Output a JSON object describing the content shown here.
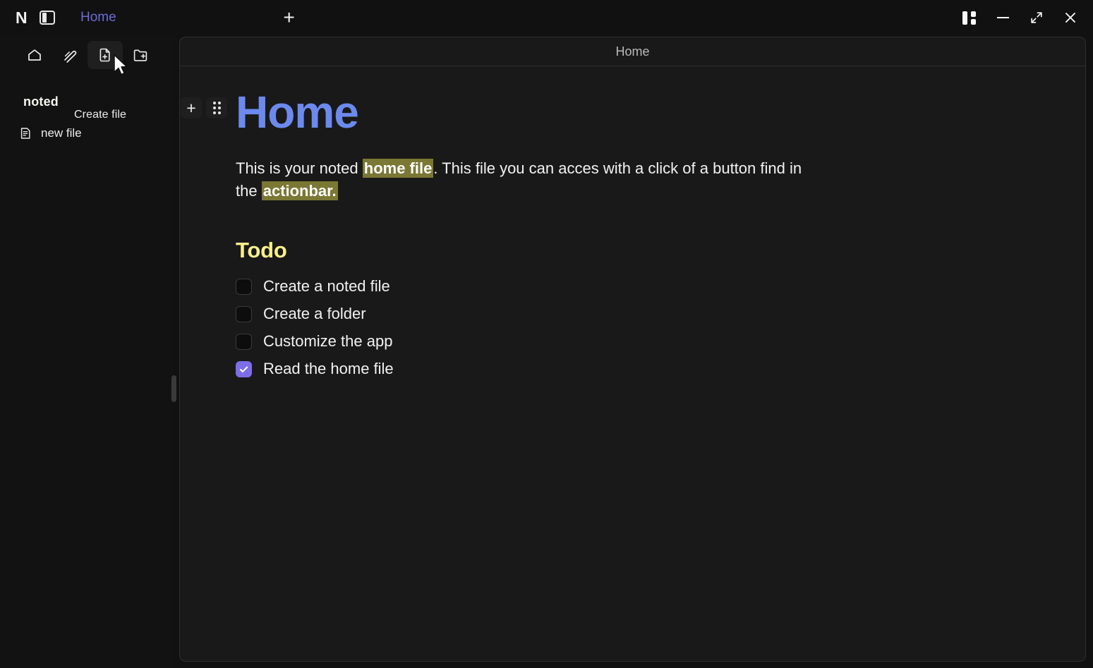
{
  "app": {
    "logo_text": "N",
    "background_color": "#111111",
    "panel_color": "#191919",
    "accent_blue": "#6c8aed",
    "accent_purple": "#7c6ee8",
    "accent_yellow": "#f6f08a",
    "highlight_color": "#7b7734",
    "tab_color": "#6c6cd8"
  },
  "titlebar": {
    "logo": "N",
    "sidebar_toggle_icon": "sidebar-toggle-icon",
    "tabs": [
      {
        "label": "Home",
        "active": true
      }
    ],
    "new_tab_label": "+",
    "window_controls": [
      {
        "name": "layout-toggle",
        "icon": "layout-icon"
      },
      {
        "name": "minimize",
        "icon": "minimize-icon"
      },
      {
        "name": "maximize",
        "icon": "expand-arrows-icon"
      },
      {
        "name": "close",
        "icon": "close-icon"
      }
    ]
  },
  "sidebar": {
    "actions": [
      {
        "name": "home",
        "icon": "home-icon",
        "tooltip": "Home",
        "hovered": false
      },
      {
        "name": "scribble",
        "icon": "pen-scribble-icon",
        "tooltip": "Scribble",
        "hovered": false
      },
      {
        "name": "create-file",
        "icon": "file-plus-icon",
        "tooltip": "Create file",
        "hovered": true
      },
      {
        "name": "create-folder",
        "icon": "folder-plus-icon",
        "tooltip": "Create folder",
        "hovered": false
      }
    ],
    "tooltip_text": "Create file",
    "workspace_name": "noted",
    "files": [
      {
        "name": "new file",
        "icon": "file-text-icon"
      }
    ]
  },
  "document": {
    "header_title": "Home",
    "title": "Home",
    "paragraph": {
      "part1": "This is your noted ",
      "highlight1": "home file",
      "part2": ". This file you can acces with a click of a button find in the ",
      "highlight2": "actionbar.",
      "part3": ""
    },
    "todo_heading": "Todo",
    "todos": [
      {
        "label": "Create a noted file",
        "checked": false
      },
      {
        "label": "Create a folder",
        "checked": false
      },
      {
        "label": "Customize the app",
        "checked": false
      },
      {
        "label": "Read the home file",
        "checked": true
      }
    ],
    "block_controls": {
      "add_label": "+",
      "drag_handle": "drag-handle-icon"
    }
  }
}
